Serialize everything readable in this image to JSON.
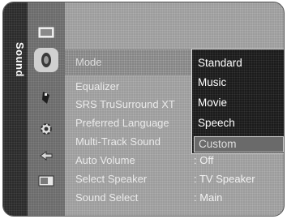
{
  "sidebar": {
    "title": "Sound"
  },
  "icons": [
    {
      "name": "picture-icon"
    },
    {
      "name": "sound-icon",
      "active": true
    },
    {
      "name": "channel-icon"
    },
    {
      "name": "setup-icon"
    },
    {
      "name": "input-icon"
    },
    {
      "name": "application-icon"
    }
  ],
  "menu": {
    "mode_label": "Mode",
    "items": [
      {
        "label": "Equalizer",
        "value": ""
      },
      {
        "label": "SRS TruSurround XT",
        "value": ""
      },
      {
        "label": "Preferred Language",
        "value": ""
      },
      {
        "label": "Multi-Track Sound",
        "value": ""
      },
      {
        "label": "Auto Volume",
        "value": ": Off"
      },
      {
        "label": "Select Speaker",
        "value": ": TV Speaker"
      },
      {
        "label": "Sound Select",
        "value": ": Main"
      }
    ]
  },
  "dropdown": {
    "options": [
      "Standard",
      "Music",
      "Movie",
      "Speech",
      "Custom"
    ],
    "selected": "Custom"
  }
}
